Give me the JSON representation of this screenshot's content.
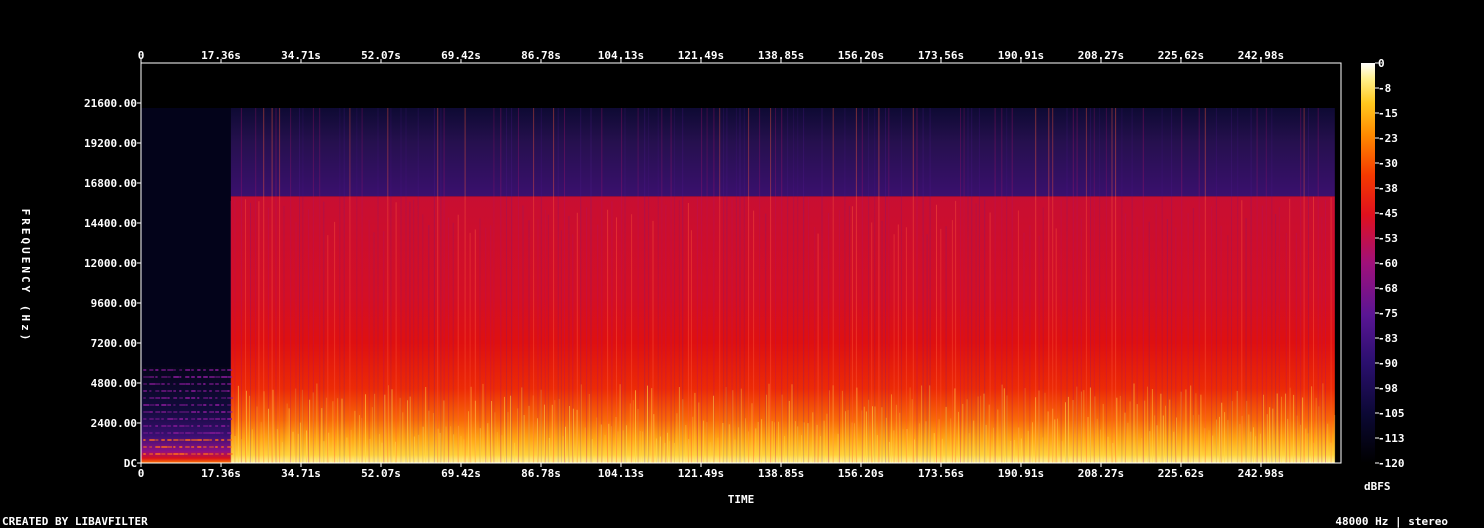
{
  "chart_data": {
    "type": "heatmap",
    "title": "",
    "xlabel": "TIME",
    "ylabel": "FREQUENCY (Hz)",
    "x_ticks": [
      "0",
      "17.36s",
      "34.71s",
      "52.07s",
      "69.42s",
      "86.78s",
      "104.13s",
      "121.49s",
      "138.85s",
      "156.20s",
      "173.56s",
      "190.91s",
      "208.27s",
      "225.62s",
      "242.98s"
    ],
    "x_tick_values": [
      0,
      17.36,
      34.71,
      52.07,
      69.42,
      86.78,
      104.13,
      121.49,
      138.85,
      156.2,
      173.56,
      190.91,
      208.27,
      225.62,
      242.98
    ],
    "xlim": [
      0,
      260.34
    ],
    "y_ticks": [
      "DC",
      "2400.00",
      "4800.00",
      "7200.00",
      "9600.00",
      "12000.00",
      "14400.00",
      "16800.00",
      "19200.00",
      "21600.00"
    ],
    "y_tick_values": [
      0,
      2400,
      4800,
      7200,
      9600,
      12000,
      14400,
      16800,
      19200,
      21600
    ],
    "ylim": [
      0,
      24000
    ],
    "colorbar": {
      "label": "dBFS",
      "ticks": [
        "0",
        "-8",
        "-15",
        "-23",
        "-30",
        "-38",
        "-45",
        "-53",
        "-60",
        "-68",
        "-75",
        "-83",
        "-90",
        "-98",
        "-105",
        "-113",
        "-120"
      ],
      "range": [
        -120,
        0
      ]
    },
    "description_regions": {
      "intro_end_s": 19.5,
      "intro_max_freq_hz": 5800,
      "cutoff_freq_hz": 16000,
      "upper_band_max_hz": 21300,
      "music_end_s": 259
    }
  },
  "footer": {
    "left": "CREATED BY LIBAVFILTER",
    "right": "48000 Hz | stereo"
  }
}
